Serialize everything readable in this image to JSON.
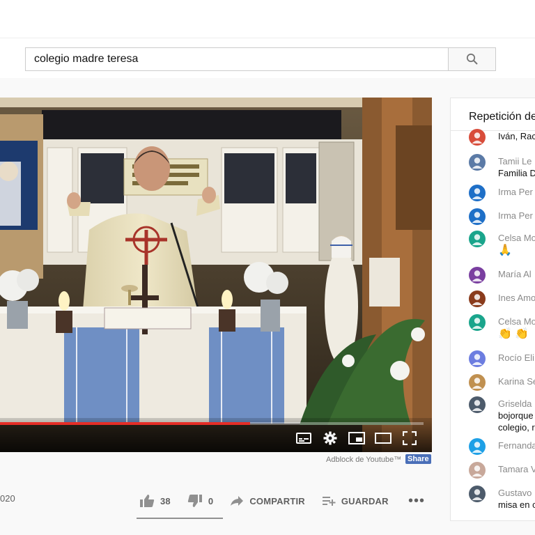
{
  "search": {
    "value": "colegio madre teresa"
  },
  "video": {
    "watermark": "Adblock de Youtube™",
    "share_label": "Share",
    "progress_fraction": 0.59
  },
  "meta": {
    "date_fragment": "020",
    "like_count": "38",
    "dislike_count": "0",
    "share_label": "COMPARTIR",
    "save_label": "GUARDAR",
    "more_label": "•••"
  },
  "chat": {
    "title": "Repetición de",
    "messages": [
      {
        "author": "",
        "text": "Iván, Rac",
        "avatar_color": "#d84c3a"
      },
      {
        "author": "Tamii Le",
        "text": "Familia D",
        "avatar_color": "#5b7aa6"
      },
      {
        "author": "Irma Per",
        "text": "",
        "avatar_color": "#1e6fc7"
      },
      {
        "author": "Irma Per",
        "text": "",
        "avatar_color": "#1e6fc7"
      },
      {
        "author": "Celsa Mo",
        "text": "🙏",
        "avatar_color": "#1aa58c"
      },
      {
        "author": "María Al",
        "text": "",
        "avatar_color": "#7a3fa0"
      },
      {
        "author": "Ines Amo",
        "text": "",
        "avatar_color": "#8a3b1c"
      },
      {
        "author": "Celsa Mo",
        "text": "👏 👏",
        "avatar_color": "#1aa58c"
      },
      {
        "author": "Rocío Eli",
        "text": "",
        "avatar_color": "#6c7de0"
      },
      {
        "author": "Karina Se",
        "text": "",
        "avatar_color": "#c09050"
      },
      {
        "author": "Griselda",
        "text": "bojorque",
        "text2": "colegio, r",
        "avatar_color": "#4d5b6b"
      },
      {
        "author": "Fernanda",
        "text": "",
        "avatar_color": "#1ea0e6"
      },
      {
        "author": "Tamara V",
        "text": "",
        "avatar_color": "#c8a89a"
      },
      {
        "author": "Gustavo",
        "text": "misa en c",
        "avatar_color": "#4d5b6b"
      }
    ]
  },
  "colors": {
    "accent_red": "#e52d27",
    "chat_title": "#111111",
    "author_gray": "#8a8a8a"
  },
  "icons": [
    "search-icon",
    "subtitles-icon",
    "settings-icon",
    "miniplayer-icon",
    "theater-icon",
    "fullscreen-icon",
    "thumb-up-icon",
    "thumb-down-icon",
    "share-arrow-icon",
    "playlist-add-icon"
  ]
}
